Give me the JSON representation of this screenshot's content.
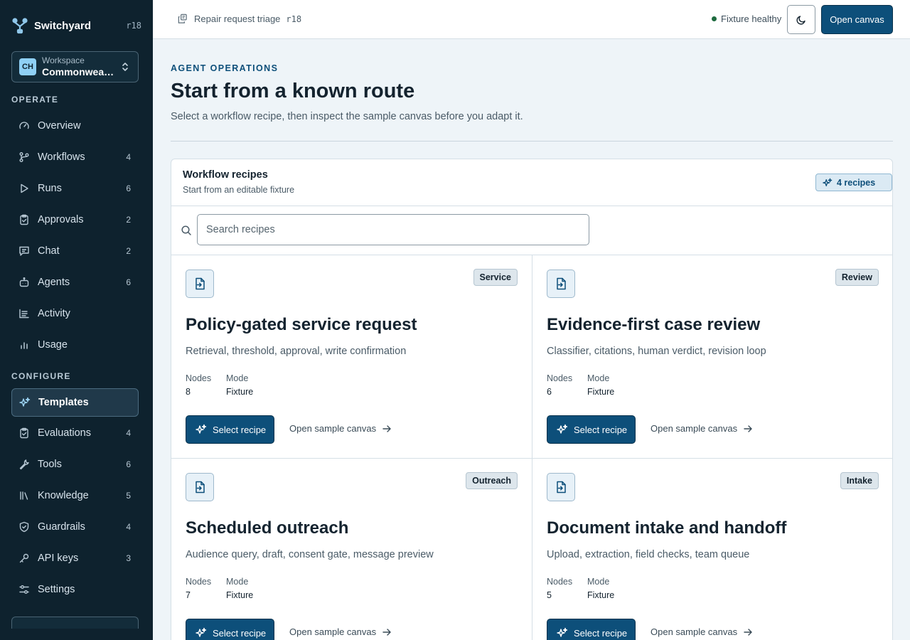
{
  "sidebar": {
    "brand": "Switchyard",
    "revision": "r18",
    "workspace": {
      "initials": "CH",
      "label": "Workspace",
      "value": "Commonwealth Housing"
    },
    "operate_label": "OPERATE",
    "configure_label": "CONFIGURE",
    "operate": [
      {
        "label": "Overview",
        "count": "",
        "icon": "gauge-icon"
      },
      {
        "label": "Workflows",
        "count": "4",
        "icon": "workflow-icon"
      },
      {
        "label": "Runs",
        "count": "6",
        "icon": "play-icon"
      },
      {
        "label": "Approvals",
        "count": "2",
        "icon": "clipboard-check-icon"
      },
      {
        "label": "Chat",
        "count": "2",
        "icon": "chat-icon"
      },
      {
        "label": "Agents",
        "count": "6",
        "icon": "robot-icon"
      },
      {
        "label": "Activity",
        "count": "",
        "icon": "activity-log-icon"
      },
      {
        "label": "Usage",
        "count": "",
        "icon": "bar-chart-icon"
      }
    ],
    "configure": [
      {
        "label": "Templates",
        "count": "",
        "icon": "sparkles-icon",
        "active": true
      },
      {
        "label": "Evaluations",
        "count": "4",
        "icon": "clipboard-check-icon"
      },
      {
        "label": "Tools",
        "count": "6",
        "icon": "wrench-icon"
      },
      {
        "label": "Knowledge",
        "count": "5",
        "icon": "library-icon"
      },
      {
        "label": "Guardrails",
        "count": "4",
        "icon": "shield-icon"
      },
      {
        "label": "API keys",
        "count": "3",
        "icon": "key-icon"
      },
      {
        "label": "Settings",
        "count": "",
        "icon": "sliders-icon"
      }
    ]
  },
  "topbar": {
    "breadcrumb": "Repair request triage",
    "revision": "r18",
    "health": "Fixture healthy",
    "open_canvas": "Open canvas",
    "colors": {
      "accent": "#0d4f7a",
      "health": "#1e6b3f"
    }
  },
  "main": {
    "eyebrow": "AGENT OPERATIONS",
    "title": "Start from a known route",
    "subtitle": "Select a workflow recipe, then inspect the sample canvas before you adapt it."
  },
  "recipes": {
    "title": "Workflow recipes",
    "subtitle": "Start from an editable fixture",
    "count": "4 recipes",
    "search_placeholder": "Search recipes",
    "nodes_label": "Nodes",
    "mode_label": "Mode",
    "select_label": "Select recipe",
    "open_label": "Open sample canvas",
    "items": [
      {
        "tag": "Service",
        "name": "Policy-gated service request",
        "desc": "Retrieval, threshold, approval, write confirmation",
        "nodes": "8",
        "mode": "Fixture"
      },
      {
        "tag": "Review",
        "name": "Evidence-first case review",
        "desc": "Classifier, citations, human verdict, revision loop",
        "nodes": "6",
        "mode": "Fixture"
      },
      {
        "tag": "Outreach",
        "name": "Scheduled outreach",
        "desc": "Audience query, draft, consent gate, message preview",
        "nodes": "7",
        "mode": "Fixture"
      },
      {
        "tag": "Intake",
        "name": "Document intake and handoff",
        "desc": "Upload, extraction, field checks, team queue",
        "nodes": "5",
        "mode": "Fixture"
      }
    ]
  }
}
